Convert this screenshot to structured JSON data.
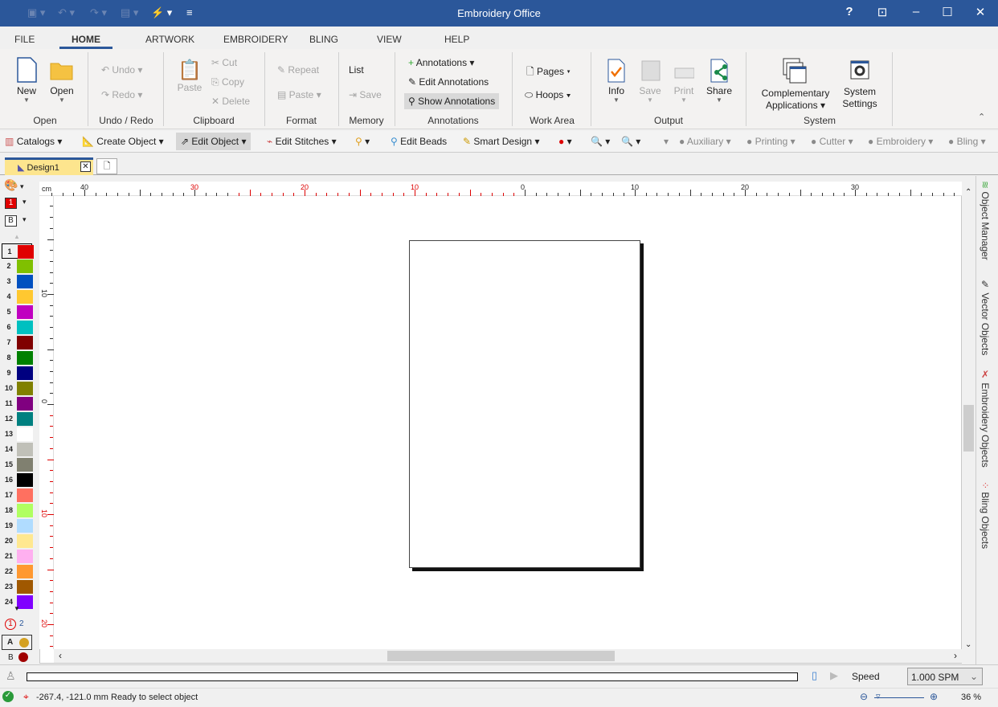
{
  "app": {
    "title": "Embroidery Office"
  },
  "ribbon_tabs": [
    "FILE",
    "HOME",
    "ARTWORK",
    "EMBROIDERY",
    "BLING",
    "VIEW",
    "HELP"
  ],
  "active_tab": "HOME",
  "groups": {
    "open": {
      "label": "Open",
      "new": "New",
      "open": "Open"
    },
    "undo": {
      "label": "Undo / Redo",
      "undo": "Undo",
      "redo": "Redo"
    },
    "clipboard": {
      "label": "Clipboard",
      "paste": "Paste",
      "cut": "Cut",
      "copy": "Copy",
      "delete": "Delete"
    },
    "format": {
      "label": "Format",
      "repeat": "Repeat",
      "paste": "Paste"
    },
    "memory": {
      "label": "Memory",
      "list": "List",
      "save": "Save"
    },
    "annotations": {
      "label": "Annotations",
      "annotations": "Annotations",
      "edit": "Edit Annotations",
      "show": "Show Annotations"
    },
    "workarea": {
      "label": "Work Area",
      "pages": "Pages",
      "hoops": "Hoops"
    },
    "output": {
      "label": "Output",
      "info": "Info",
      "save": "Save",
      "print": "Print",
      "share": "Share"
    },
    "system": {
      "label": "System",
      "complementary_1": "Complementary",
      "complementary_2": "Applications",
      "settings_1": "System",
      "settings_2": "Settings"
    }
  },
  "toolbar": {
    "catalogs": "Catalogs",
    "create_object": "Create Object",
    "edit_object": "Edit Object",
    "edit_stitches": "Edit Stitches",
    "edit_beads": "Edit Beads",
    "smart_design": "Smart Design",
    "auxiliary": "Auxiliary",
    "printing": "Printing",
    "cutter": "Cutter",
    "embroidery": "Embroidery",
    "bling": "Bling"
  },
  "document_tab": "Design1",
  "left_panel": {
    "color_indicator": "1",
    "mode_indicator": "B",
    "page_1": "1",
    "page_2": "2",
    "layer_a": "A",
    "layer_b": "B"
  },
  "palette": [
    "#e00000",
    "#80c000",
    "#0050c0",
    "#ffc830",
    "#c000c0",
    "#00c0c0",
    "#800000",
    "#008000",
    "#000080",
    "#808000",
    "#800080",
    "#008080",
    "#ffffff",
    "#c0c0b8",
    "#808070",
    "#000000",
    "#ff7060",
    "#b0ff60",
    "#b0dcff",
    "#ffe890",
    "#ffb0f0",
    "#ff9830",
    "#a05800",
    "#8000ff"
  ],
  "ruler": {
    "unit": "cm",
    "top_labels": [
      "40",
      "30",
      "20",
      "10",
      "0",
      "10",
      "20",
      "30"
    ],
    "left_labels": [
      "10",
      "0",
      "10",
      "20"
    ]
  },
  "right_panel": [
    "Object Manager",
    "Vector Objects",
    "Embroidery Objects",
    "Bling Objects"
  ],
  "progress": {
    "speed_label": "Speed",
    "speed_value": "1.000 SPM"
  },
  "status": {
    "coords": "-267.4, -121.0 mm",
    "message": "Ready to select object",
    "zoom": "36 %"
  }
}
